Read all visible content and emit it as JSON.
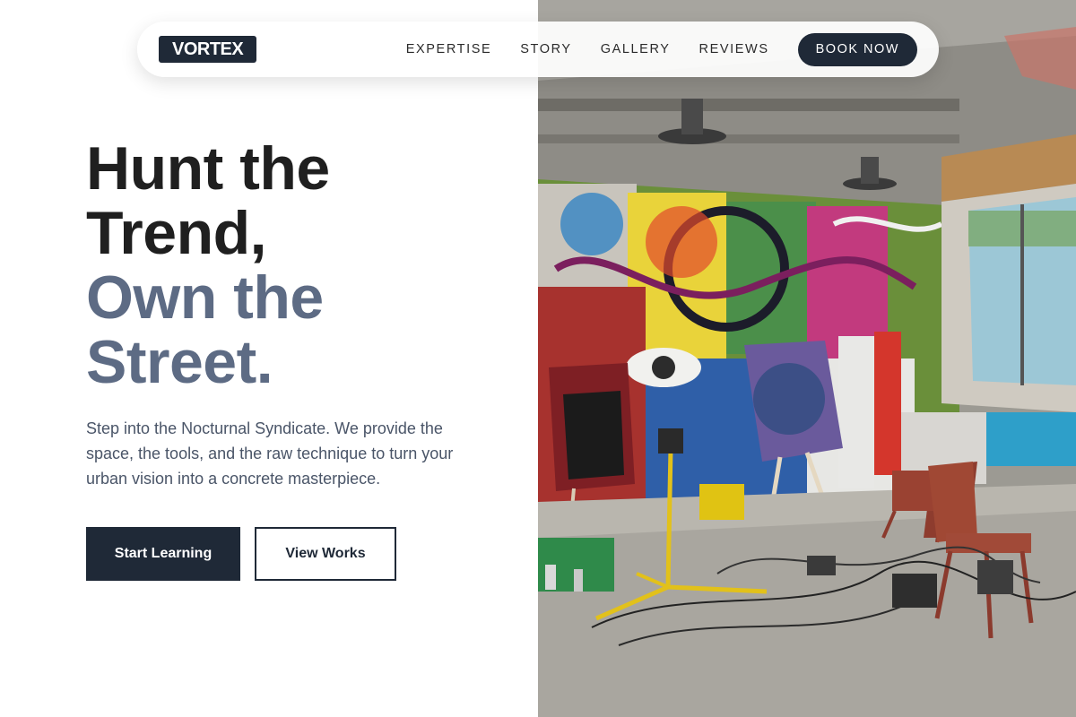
{
  "brand": {
    "logo_text": "VORTEX"
  },
  "nav": {
    "links": [
      "EXPERTISE",
      "STORY",
      "GALLERY",
      "REVIEWS"
    ],
    "cta_label": "BOOK NOW"
  },
  "hero": {
    "headline_line1": "Hunt the",
    "headline_line2": "Trend,",
    "headline_line3": "Own the",
    "headline_line4": "Street.",
    "lead": "Step into the Nocturnal Syndicate. We provide the space, the tools, and the raw technique to turn your urban vision into a concrete masterpiece.",
    "primary_cta": "Start Learning",
    "secondary_cta": "View Works"
  },
  "colors": {
    "navy": "#1f2937",
    "headline_dark": "#1f1f1f",
    "headline_accent": "#5d6b84",
    "body_text": "#4a5568"
  }
}
